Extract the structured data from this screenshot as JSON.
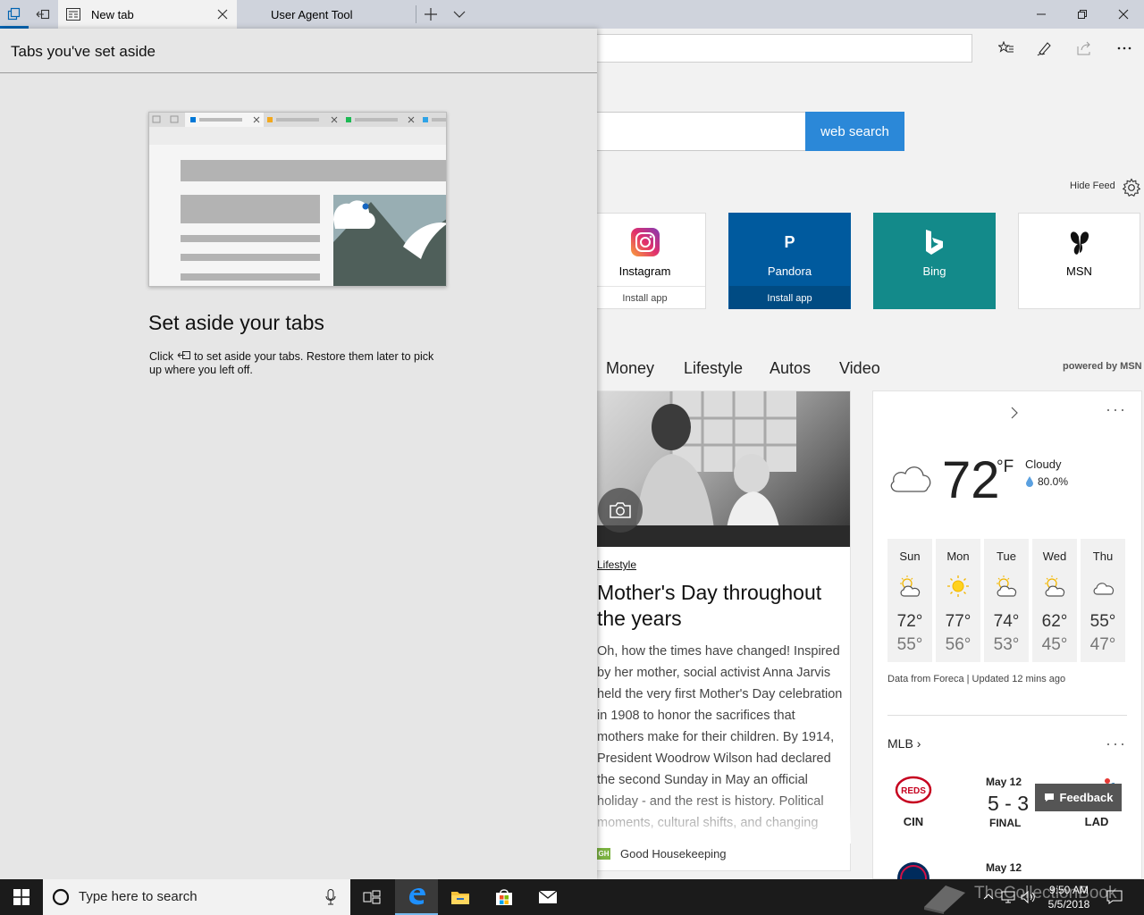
{
  "tabs": [
    {
      "label": "New tab",
      "active": true
    },
    {
      "label": "User Agent Tool",
      "active": false
    }
  ],
  "panel": {
    "title": "Tabs you've set aside",
    "heading": "Set aside your tabs",
    "desc_before": "Click",
    "desc_after": "to set aside your tabs. Restore them later to pick up where you left off."
  },
  "search": {
    "button": "web search"
  },
  "feed": {
    "hide_label": "Hide Feed",
    "powered": "powered by MSN"
  },
  "tiles": [
    {
      "name": "Instagram",
      "install": "Install app"
    },
    {
      "name": "Pandora",
      "letter": "P",
      "install": "Install app"
    },
    {
      "name": "Bing"
    },
    {
      "name": "MSN"
    }
  ],
  "categories": [
    "Money",
    "Lifestyle",
    "Autos",
    "Video"
  ],
  "article": {
    "category": "Lifestyle",
    "title": "Mother's Day throughout the years",
    "body": "Oh, how the times have changed! Inspired by her mother, social activist Anna Jarvis held the very first Mother's Day celebration in 1908 to honor the sacrifices that mothers make for their children. By 1914, President Woodrow Wilson had declared the second Sunday in May an official holiday - and the rest is history. Political moments, cultural shifts, and changing styles have",
    "source": "Good Housekeeping",
    "source_badge": "GH"
  },
  "weather": {
    "temp": "72",
    "unit": "°F",
    "condition": "Cloudy",
    "humidity": "80.0%",
    "forecast": [
      {
        "day": "Sun",
        "hi": "72°",
        "lo": "55°",
        "icon": "partly-sunny-icon"
      },
      {
        "day": "Mon",
        "hi": "77°",
        "lo": "56°",
        "icon": "sunny-icon"
      },
      {
        "day": "Tue",
        "hi": "74°",
        "lo": "53°",
        "icon": "partly-sunny-icon"
      },
      {
        "day": "Wed",
        "hi": "62°",
        "lo": "45°",
        "icon": "partly-sunny-icon"
      },
      {
        "day": "Thu",
        "hi": "55°",
        "lo": "47°",
        "icon": "cloudy-icon"
      }
    ],
    "note": "Data from Foreca | Updated 12 mins ago"
  },
  "sports": {
    "league": "MLB",
    "game": {
      "date": "May 12",
      "score": "5 - 3",
      "status": "FINAL",
      "home": "CIN",
      "away": "LAD",
      "home_logo": "REDS",
      "away_logo": "Dodgers"
    },
    "next_date": "May 12"
  },
  "feedback": "Feedback",
  "taskbar": {
    "search_placeholder": "Type here to search",
    "time": "9:50 AM",
    "date": "5/5/2018",
    "watermark": "TheCollectionBook"
  },
  "colors": {
    "accent": "#2b88d8",
    "pandora": "#005a9e",
    "bing": "#138a8a",
    "taskbar": "#1b1b1b"
  }
}
